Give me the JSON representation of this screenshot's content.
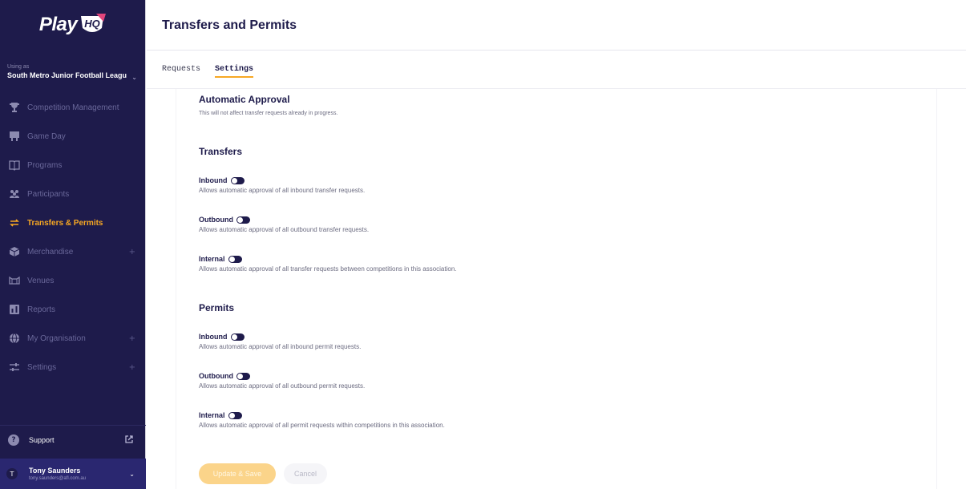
{
  "brand": {
    "logo_text": "Play",
    "logo_badge": "HQ",
    "accent_color": "#f7a823",
    "sidebar_bg": "#1e1b4b"
  },
  "org": {
    "using_as": "Using as",
    "name": "South Metro Junior Football Leagu"
  },
  "nav": [
    {
      "label": "Competition Management",
      "icon": "trophy-icon",
      "active": false,
      "expandable": false
    },
    {
      "label": "Game Day",
      "icon": "scoreboard-icon",
      "active": false,
      "expandable": false
    },
    {
      "label": "Programs",
      "icon": "book-icon",
      "active": false,
      "expandable": false
    },
    {
      "label": "Participants",
      "icon": "users-icon",
      "active": false,
      "expandable": false
    },
    {
      "label": "Transfers & Permits",
      "icon": "transfer-arrows-icon",
      "active": true,
      "expandable": false
    },
    {
      "label": "Merchandise",
      "icon": "box-icon",
      "active": false,
      "expandable": true
    },
    {
      "label": "Venues",
      "icon": "stadium-icon",
      "active": false,
      "expandable": false
    },
    {
      "label": "Reports",
      "icon": "report-icon",
      "active": false,
      "expandable": false
    },
    {
      "label": "My Organisation",
      "icon": "globe-icon",
      "active": false,
      "expandable": true
    },
    {
      "label": "Settings",
      "icon": "sliders-icon",
      "active": false,
      "expandable": true
    }
  ],
  "support": {
    "label": "Support"
  },
  "user": {
    "initial": "T",
    "name": "Tony Saunders",
    "email": "tony.saunders@afl.com.au"
  },
  "header": {
    "title": "Transfers and Permits"
  },
  "tabs": [
    {
      "label": "Requests",
      "active": false
    },
    {
      "label": "Settings",
      "active": true
    }
  ],
  "settings": {
    "title": "Automatic Approval",
    "subtitle": "This will not affect transfer requests already in progress.",
    "transfers": {
      "title": "Transfers",
      "rows": [
        {
          "label": "Inbound",
          "desc": "Allows automatic approval of all inbound transfer requests.",
          "enabled": false
        },
        {
          "label": "Outbound",
          "desc": "Allows automatic approval of all outbound transfer requests.",
          "enabled": false
        },
        {
          "label": "Internal",
          "desc": "Allows automatic approval of all transfer requests between competitions in this association.",
          "enabled": false
        }
      ]
    },
    "permits": {
      "title": "Permits",
      "rows": [
        {
          "label": "Inbound",
          "desc": "Allows automatic approval of all inbound permit requests.",
          "enabled": false
        },
        {
          "label": "Outbound",
          "desc": "Allows automatic approval of all outbound permit requests.",
          "enabled": false
        },
        {
          "label": "Internal",
          "desc": "Allows automatic approval of all permit requests within competitions in this association.",
          "enabled": false
        }
      ]
    },
    "save_label": "Update & Save",
    "cancel_label": "Cancel"
  }
}
